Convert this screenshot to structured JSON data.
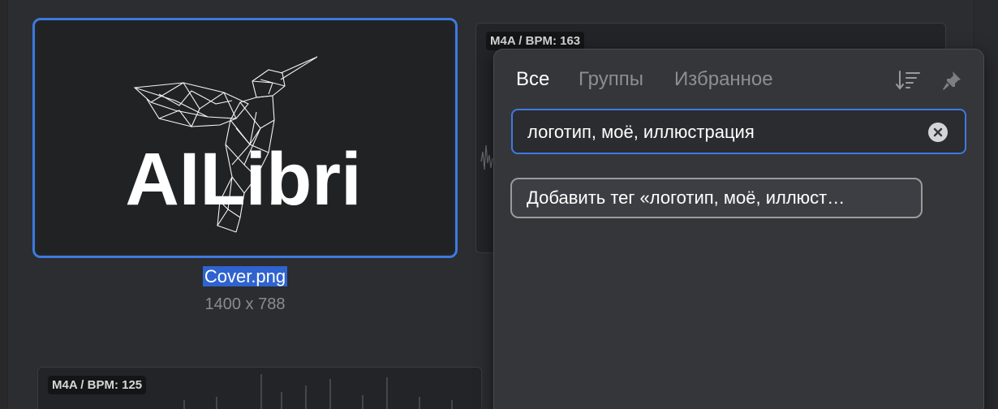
{
  "thumbnail": {
    "logo_text": "AILibri",
    "file_name": "Cover.png",
    "dimensions": "1400 x 788"
  },
  "audio_cards": {
    "top": {
      "badge": "M4A / BPM: 163"
    },
    "bottom": {
      "badge": "M4A / BPM: 125"
    }
  },
  "tag_panel": {
    "tabs": [
      {
        "label": "Все",
        "active": true
      },
      {
        "label": "Группы",
        "active": false
      },
      {
        "label": "Избранное",
        "active": false
      }
    ],
    "icons": {
      "sort": "sort-icon",
      "pin": "pin-icon",
      "clear": "clear-icon"
    },
    "search": {
      "value": "логотип, моё, иллюстрация"
    },
    "add_tag_label": "Добавить тег «логотип, моё, иллюст…"
  },
  "colors": {
    "accent": "#3d7ae0",
    "selection": "#2f63cf",
    "panel_bg": "#35363a",
    "page_bg": "#2c2d30"
  }
}
